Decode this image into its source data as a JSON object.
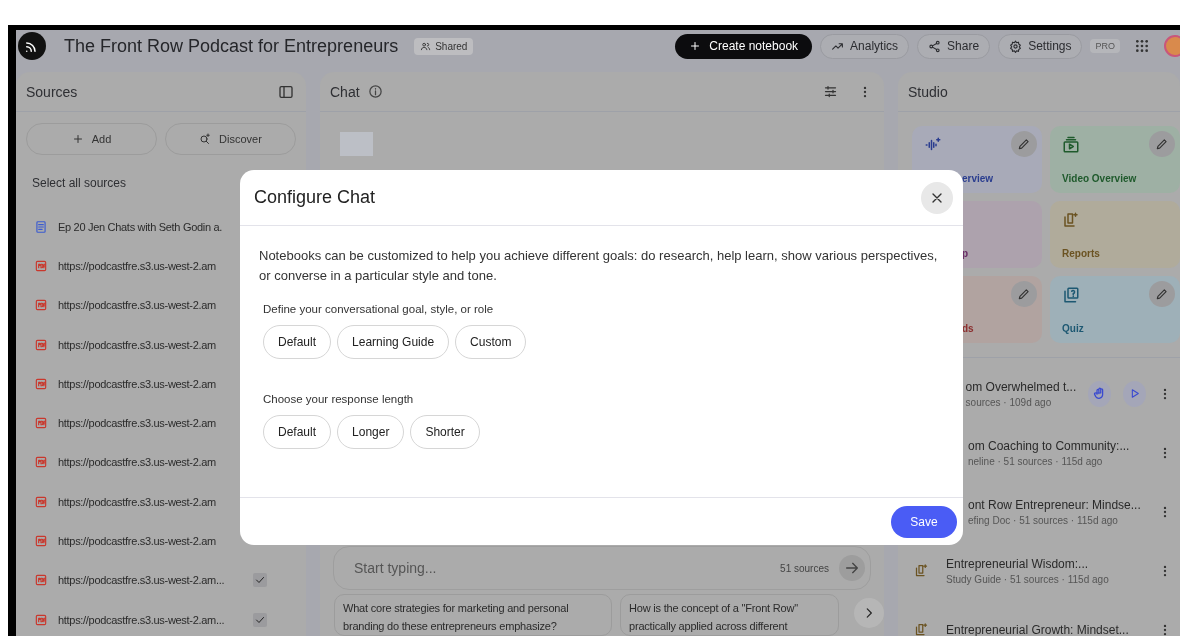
{
  "app_bar": {
    "title": "The Front Row Podcast for Entrepreneurs",
    "shared_label": "Shared",
    "create_label": "Create notebook",
    "actions": [
      {
        "kind": "analytics",
        "label": "Analytics"
      },
      {
        "kind": "share",
        "label": "Share"
      },
      {
        "kind": "settings",
        "label": "Settings"
      }
    ],
    "plan_badge": "PRO"
  },
  "sources": {
    "title": "Sources",
    "add_label": "Add",
    "discover_label": "Discover",
    "select_all_label": "Select all sources",
    "items": [
      {
        "kind": "doc",
        "title": "Ep 20 Jen Chats with Seth Godin a."
      },
      {
        "kind": "pdf",
        "title": "https://podcastfre.s3.us-west-2.am"
      },
      {
        "kind": "pdf",
        "title": "https://podcastfre.s3.us-west-2.am"
      },
      {
        "kind": "pdf",
        "title": "https://podcastfre.s3.us-west-2.am"
      },
      {
        "kind": "pdf",
        "title": "https://podcastfre.s3.us-west-2.am"
      },
      {
        "kind": "pdf",
        "title": "https://podcastfre.s3.us-west-2.am"
      },
      {
        "kind": "pdf",
        "title": "https://podcastfre.s3.us-west-2.am"
      },
      {
        "kind": "pdf",
        "title": "https://podcastfre.s3.us-west-2.am"
      },
      {
        "kind": "pdf",
        "title": "https://podcastfre.s3.us-west-2.am"
      },
      {
        "kind": "pdf",
        "title": "https://podcastfre.s3.us-west-2.am...",
        "checked": true
      },
      {
        "kind": "pdf",
        "title": "https://podcastfre.s3.us-west-2.am...",
        "checked": true
      }
    ]
  },
  "chat": {
    "title": "Chat",
    "input": {
      "placeholder": "Start typing..."
    },
    "source_count": "51 sources",
    "suggestions": [
      "What core strategies for marketing and personal branding do these entrepreneurs emphasize?",
      "How is the concept of a \"Front Row\" practically applied across different"
    ]
  },
  "studio": {
    "title": "Studio",
    "tiles": [
      {
        "kind": "audio",
        "label": "erview",
        "covered": true
      },
      {
        "kind": "video",
        "label": "Video Overview",
        "covered": false
      },
      {
        "kind": "mindmap",
        "label": "p",
        "covered": true
      },
      {
        "kind": "reports",
        "label": "Reports",
        "covered": false
      },
      {
        "kind": "flashcards",
        "label": "ds",
        "covered": true
      },
      {
        "kind": "quiz",
        "label": "Quiz",
        "covered": false
      }
    ],
    "notes": [
      {
        "kind": "audio",
        "title": "om Overwhelmed t...",
        "meta": "sources · 109d ago",
        "covered": true
      },
      {
        "kind": "note",
        "title": "om Coaching to Community:...",
        "meta": "neline · 51 sources · 115d ago",
        "covered": true
      },
      {
        "kind": "note",
        "title": "ont Row Entrepreneur: Mindse...",
        "meta": "efing Doc · 51 sources · 115d ago",
        "covered": true
      },
      {
        "kind": "note",
        "title": "Entrepreneurial Wisdom:...",
        "meta": "Study Guide · 51 sources · 115d ago",
        "covered": false
      },
      {
        "kind": "note",
        "title": "Entrepreneurial Growth: Mindset...",
        "covered": false
      }
    ]
  },
  "dialog": {
    "title": "Configure Chat",
    "description": "Notebooks can be customized to help you achieve different goals: do research, help learn, show various perspectives, or converse in a particular style and tone.",
    "groups": [
      {
        "label": "Define your conversational goal, style, or role",
        "options": [
          {
            "label": "Default",
            "selected": false
          },
          {
            "label": "Learning Guide",
            "selected": false
          },
          {
            "label": "Custom",
            "selected": false
          }
        ]
      },
      {
        "label": "Choose your response length",
        "options": [
          {
            "label": "Default",
            "selected": false
          },
          {
            "label": "Longer",
            "selected": false
          },
          {
            "label": "Shorter",
            "selected": false
          }
        ]
      }
    ],
    "save_label": "Save"
  }
}
